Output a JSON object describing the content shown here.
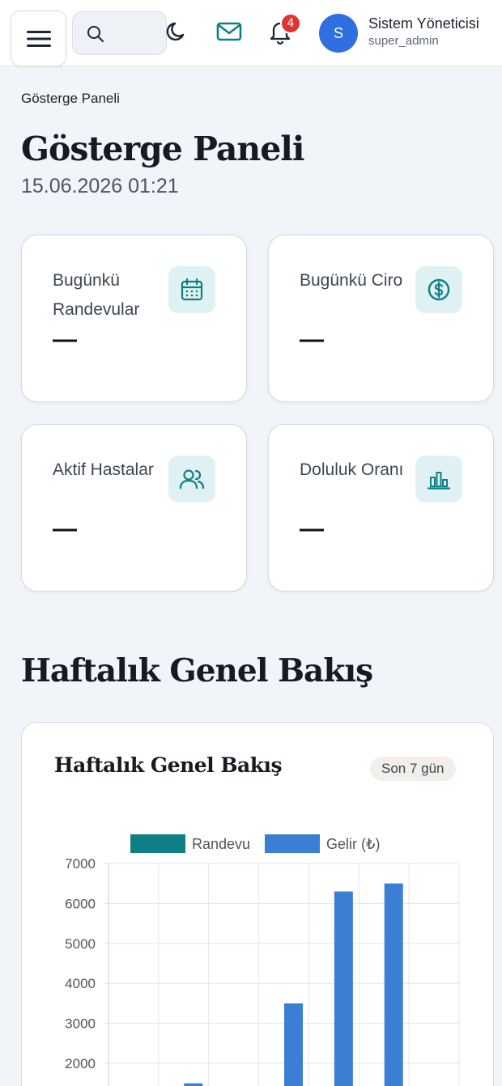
{
  "header": {
    "user_name": "Sistem Yöneticisi",
    "user_role": "super_admin",
    "avatar_initial": "S",
    "notification_count": "4",
    "icons": [
      "menu-icon",
      "search-icon",
      "moon-icon",
      "mail-icon",
      "bell-icon"
    ]
  },
  "breadcrumb": "Gösterge Paneli",
  "page": {
    "title": "Gösterge Paneli",
    "datetime": "15.06.2026 01:21"
  },
  "stats": [
    {
      "label": "Bugünkü Randevular",
      "value": "—",
      "icon": "calendar-icon"
    },
    {
      "label": "Bugünkü Ciro",
      "value": "—",
      "icon": "dollar-icon"
    },
    {
      "label": "Aktif Hastalar",
      "value": "—",
      "icon": "users-icon"
    },
    {
      "label": "Doluluk Oranı",
      "value": "—",
      "icon": "bar-chart-icon"
    }
  ],
  "section_title": "Haftalık Genel Bakış",
  "chart_card": {
    "title": "Haftalık Genel Bakış",
    "period": "Son 7 gün"
  },
  "colors": {
    "accent": "#0f7f86",
    "series_randevu": "#0f7f86",
    "series_gelir": "#3b7fd4",
    "badge": "#e03434",
    "avatar": "#2f6fe0"
  },
  "chart_data": {
    "type": "bar",
    "legend": [
      "Randevu",
      "Gelir (₺)"
    ],
    "series": [
      {
        "name": "Randevu",
        "values": [
          0,
          0,
          0,
          0,
          0,
          0,
          0
        ]
      },
      {
        "name": "Gelir (₺)",
        "values": [
          0,
          1500,
          0,
          3500,
          6300,
          6500,
          0
        ]
      }
    ],
    "yticks": [
      "7000",
      "6000",
      "5000",
      "4000",
      "3000",
      "2000"
    ],
    "ylim": [
      0,
      7000
    ],
    "grid": true,
    "legend_position": "top"
  }
}
